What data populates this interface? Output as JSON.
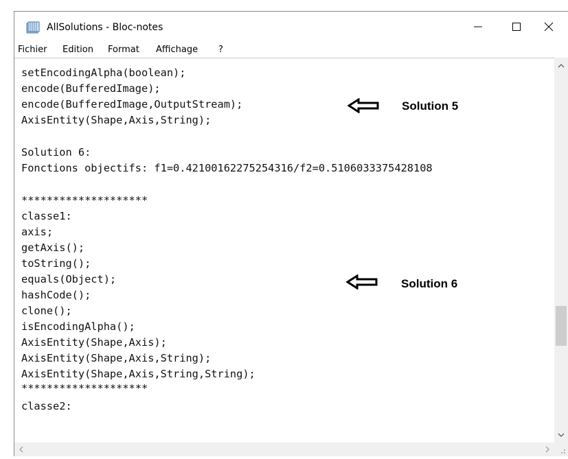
{
  "window": {
    "title": "AllSolutions - Bloc-notes",
    "controls": [
      "minimize",
      "maximize",
      "close"
    ]
  },
  "menu": [
    "Fichier",
    "Edition",
    "Format",
    "Affichage",
    "?"
  ],
  "editor": {
    "lines": [
      "setEncodingAlpha(boolean);",
      "encode(BufferedImage);",
      "encode(BufferedImage,OutputStream);",
      "AxisEntity(Shape,Axis,String);",
      "",
      "Solution 6:",
      "Fonctions objectifs: f1=0.42100162275254316/f2=0.5106033375428108",
      "",
      "********************",
      "classe1:",
      "axis;",
      "getAxis();",
      "toString();",
      "equals(Object);",
      "hashCode();",
      "clone();",
      "isEncodingAlpha();",
      "AxisEntity(Shape,Axis);",
      "AxisEntity(Shape,Axis,String);",
      "AxisEntity(Shape,Axis,String,String);",
      "********************",
      "classe2:"
    ]
  },
  "annotations": [
    {
      "label": "Solution 5",
      "icon": "left-arrow-icon"
    },
    {
      "label": "Solution 6",
      "icon": "left-arrow-icon"
    }
  ]
}
